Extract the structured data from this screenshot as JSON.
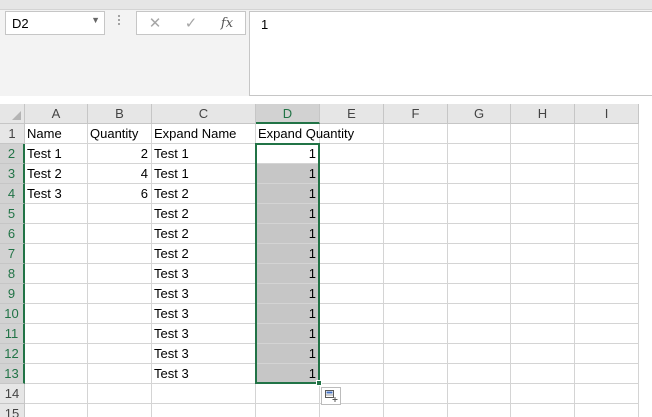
{
  "formula_bar": {
    "name_box": "D2",
    "formula": "1",
    "cancel_glyph": "✕",
    "enter_glyph": "✓",
    "insert_function_glyph": "fx"
  },
  "sheet": {
    "columns": [
      "A",
      "B",
      "C",
      "D",
      "E",
      "F",
      "G",
      "H",
      "I"
    ],
    "rows": [
      "1",
      "2",
      "3",
      "4",
      "5",
      "6",
      "7",
      "8",
      "9",
      "10",
      "11",
      "12",
      "13",
      "14",
      "15"
    ],
    "selected_column": "D",
    "selected_rows": [
      "2",
      "3",
      "4",
      "5",
      "6",
      "7",
      "8",
      "9",
      "10",
      "11",
      "12",
      "13"
    ],
    "cells": {
      "A1": "Name",
      "B1": "Quantity",
      "C1": "Expand Name",
      "D1": "Expand Quantity",
      "A2": "Test 1",
      "B2": "2",
      "C2": "Test 1",
      "D2": "1",
      "A3": "Test 2",
      "B3": "4",
      "C3": "Test 1",
      "D3": "1",
      "A4": "Test 3",
      "B4": "6",
      "C4": "Test 2",
      "D4": "1",
      "C5": "Test 2",
      "D5": "1",
      "C6": "Test 2",
      "D6": "1",
      "C7": "Test 2",
      "D7": "1",
      "C8": "Test 3",
      "D8": "1",
      "C9": "Test 3",
      "D9": "1",
      "C10": "Test 3",
      "D10": "1",
      "C11": "Test 3",
      "D11": "1",
      "C12": "Test 3",
      "D12": "1",
      "C13": "Test 3",
      "D13": "1"
    },
    "numeric_cells": [
      "B2",
      "B3",
      "B4",
      "D2",
      "D3",
      "D4",
      "D5",
      "D6",
      "D7",
      "D8",
      "D9",
      "D10",
      "D11",
      "D12",
      "D13"
    ],
    "active_cell": "D2",
    "selection_range": "D2:D13"
  },
  "colors": {
    "accent": "#217346",
    "selection_fill": "#c6c6c6",
    "header_bg": "#e6e6e6",
    "gridline": "#d4d4d4"
  },
  "icons": {
    "quick_analysis": "quick-analysis-icon"
  }
}
